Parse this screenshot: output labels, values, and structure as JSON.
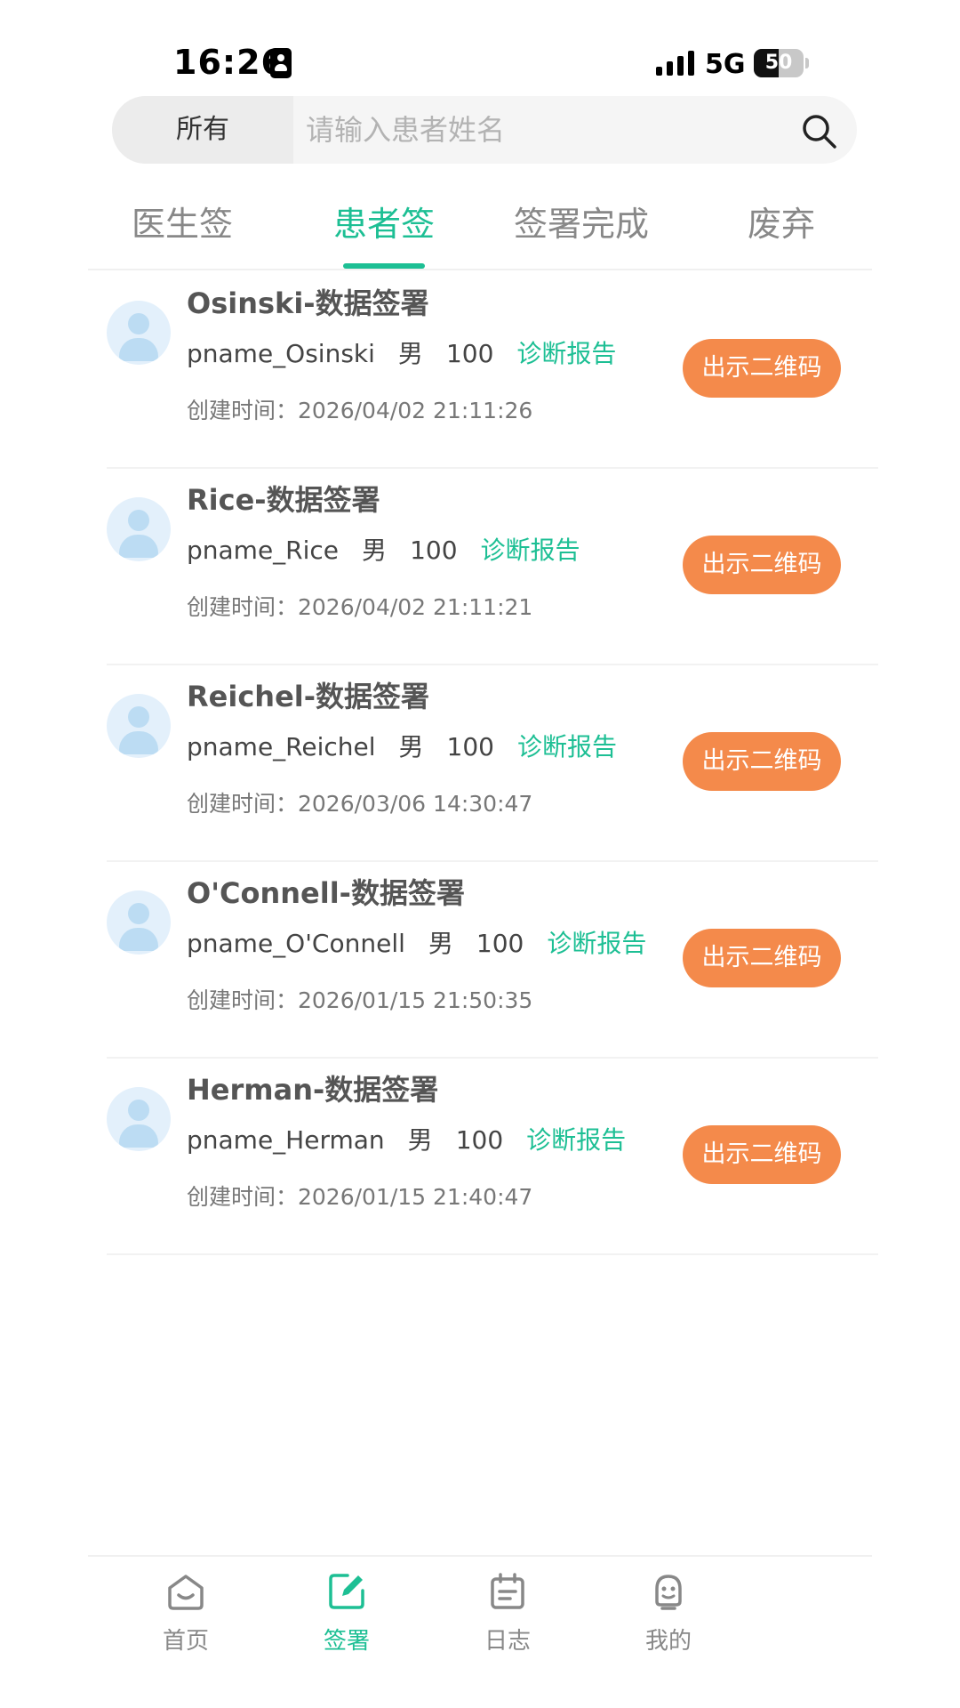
{
  "status_bar": {
    "time": "16:26",
    "network": "5G",
    "battery": "50",
    "battery_level": 0.5
  },
  "search": {
    "filter_label": "所有",
    "placeholder": "请输入患者姓名",
    "value": ""
  },
  "tabs": [
    {
      "label": "医生签",
      "active": false
    },
    {
      "label": "患者签",
      "active": true
    },
    {
      "label": "签署完成",
      "active": false
    },
    {
      "label": "废弃",
      "active": false
    }
  ],
  "records": [
    {
      "title": "Osinski-数据签署",
      "pname": "pname_Osinski",
      "gender": "男",
      "score": "100",
      "report_label": "诊断报告",
      "created": "创建时间：2026/04/02 21:11:26",
      "button_label": "出示二维码"
    },
    {
      "title": "Rice-数据签署",
      "pname": "pname_Rice",
      "gender": "男",
      "score": "100",
      "report_label": "诊断报告",
      "created": "创建时间：2026/04/02 21:11:21",
      "button_label": "出示二维码"
    },
    {
      "title": "Reichel-数据签署",
      "pname": "pname_Reichel",
      "gender": "男",
      "score": "100",
      "report_label": "诊断报告",
      "created": "创建时间：2026/03/06 14:30:47",
      "button_label": "出示二维码"
    },
    {
      "title": "O'Connell-数据签署",
      "pname": "pname_O'Connell",
      "gender": "男",
      "score": "100",
      "report_label": "诊断报告",
      "created": "创建时间：2026/01/15 21:50:35",
      "button_label": "出示二维码"
    },
    {
      "title": "Herman-数据签署",
      "pname": "pname_Herman",
      "gender": "男",
      "score": "100",
      "report_label": "诊断报告",
      "created": "创建时间：2026/01/15 21:40:47",
      "button_label": "出示二维码"
    }
  ],
  "bottom_nav": [
    {
      "label": "首页",
      "icon": "home-icon",
      "active": false
    },
    {
      "label": "签署",
      "icon": "sign-icon",
      "active": true
    },
    {
      "label": "日志",
      "icon": "calendar-icon",
      "active": false
    },
    {
      "label": "我的",
      "icon": "profile-icon",
      "active": false
    }
  ],
  "colors": {
    "accent": "#1dbf94",
    "button": "#f48a4b",
    "inactive": "#888888"
  }
}
